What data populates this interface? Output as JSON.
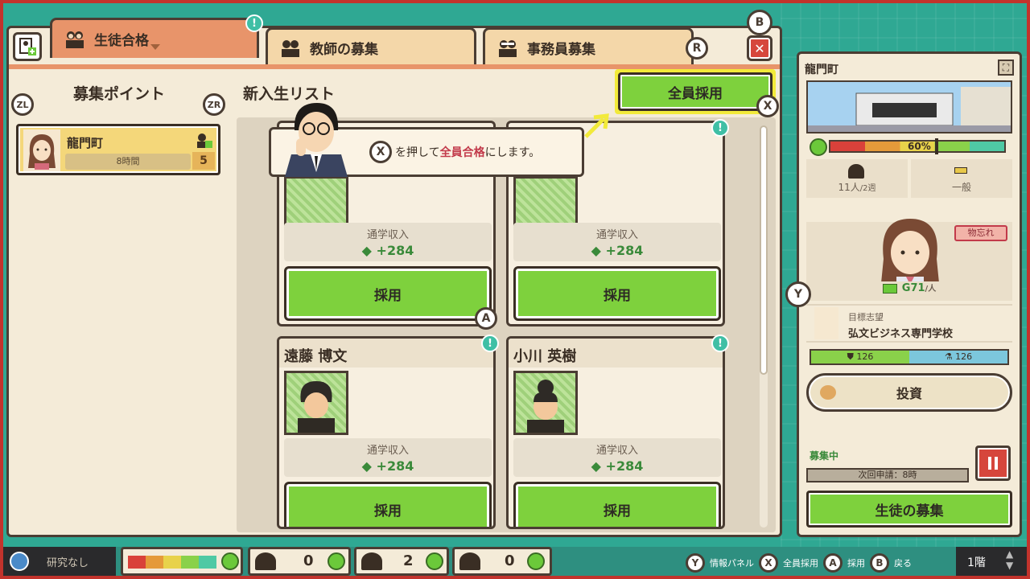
{
  "tabs": [
    {
      "label": "生徒合格"
    },
    {
      "label": "教師の募集"
    },
    {
      "label": "事務員募集"
    }
  ],
  "buttons": {
    "B": "B",
    "R": "R",
    "close": "✕",
    "ZL": "ZL",
    "ZR": "ZR",
    "X": "X",
    "A": "A",
    "Y": "Y"
  },
  "left": {
    "title": "募集ポイント",
    "town": {
      "name": "龍門町",
      "time": "8時間",
      "count": "5"
    }
  },
  "list": {
    "title": "新入生リスト",
    "hire_all": "全員採用",
    "tooltip": {
      "key": "X",
      "pre": "を押して",
      "highlight": "全員合格",
      "post": "にします。"
    }
  },
  "cards": [
    {
      "name": "",
      "income_label": "通学収入",
      "income_value": "+284",
      "hire": "採用"
    },
    {
      "name": "",
      "income_label": "通学収入",
      "income_value": "+284",
      "hire": "採用"
    },
    {
      "name": "遠藤 博文",
      "income_label": "通学収入",
      "income_value": "+284",
      "hire": "採用"
    },
    {
      "name": "小川 英樹",
      "income_label": "通学収入",
      "income_value": "+284",
      "hire": "採用"
    }
  ],
  "right": {
    "town": "龍門町",
    "meter_percent": "60%",
    "meter_value": 0.6,
    "stat_people": "11人",
    "stat_period": "/2週",
    "stat_type": "一般",
    "tag": "物忘れ",
    "fee": "G71",
    "fee_unit": "/人",
    "goal_label": "目標志望",
    "goal_school": "弘文ビジネス専門学校",
    "bar_left": "126",
    "bar_right": "126",
    "invest": "投資",
    "status": "募集中",
    "next": "次回申請：8時",
    "recruit": "生徒の募集"
  },
  "bottom": {
    "research": "研究なし",
    "counts": [
      "0",
      "2",
      "0"
    ],
    "hints": [
      {
        "key": "Y",
        "label": "情報パネル"
      },
      {
        "key": "X",
        "label": "全員採用"
      },
      {
        "key": "A",
        "label": "採用"
      },
      {
        "key": "B",
        "label": "戻る"
      }
    ],
    "floor": "1階"
  },
  "colors": {
    "accent_green": "#7ed13d",
    "highlight_yellow": "#f2ea3a",
    "frame_red": "#c2332c",
    "tab_active": "#e8946a"
  }
}
